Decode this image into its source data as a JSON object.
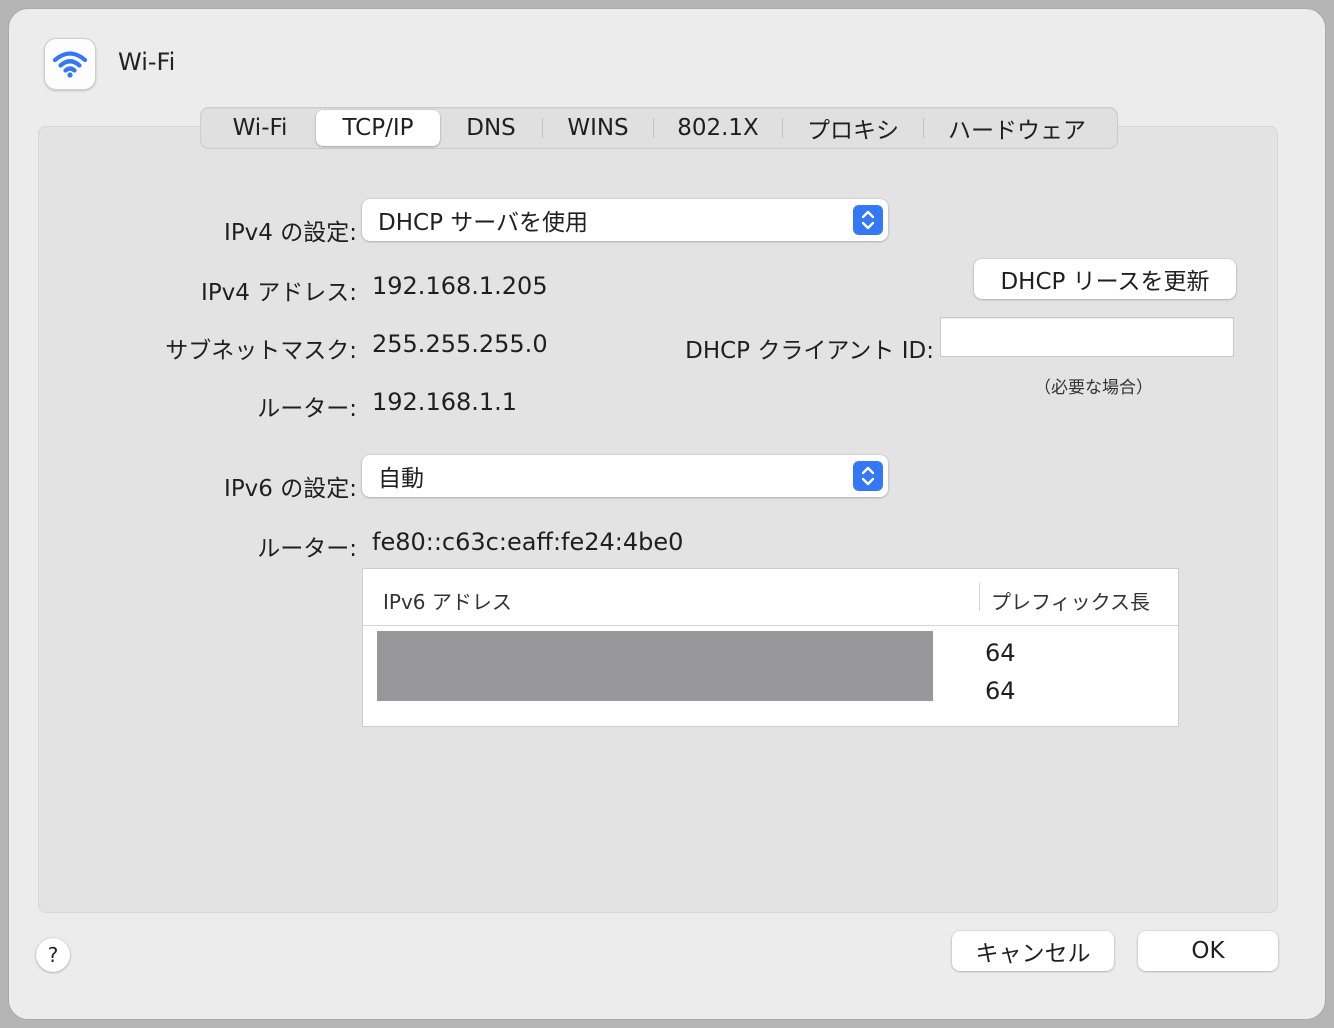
{
  "window": {
    "title": "Wi-Fi",
    "app_icon": "wifi-icon",
    "accent_color": "#3478f6"
  },
  "tabs": [
    {
      "label": "Wi-Fi",
      "active": false
    },
    {
      "label": "TCP/IP",
      "active": true
    },
    {
      "label": "DNS",
      "active": false
    },
    {
      "label": "WINS",
      "active": false
    },
    {
      "label": "802.1X",
      "active": false
    },
    {
      "label": "プロキシ",
      "active": false
    },
    {
      "label": "ハードウェア",
      "active": false
    }
  ],
  "ipv4": {
    "config_label": "IPv4 の設定:",
    "config_value": "DHCP サーバを使用",
    "address_label": "IPv4 アドレス:",
    "address_value": "192.168.1.205",
    "subnet_label": "サブネットマスク:",
    "subnet_value": "255.255.255.0",
    "router_label": "ルーター:",
    "router_value": "192.168.1.1",
    "renew_button": "DHCP リースを更新",
    "client_id_label": "DHCP クライアント ID:",
    "client_id_value": "",
    "client_id_hint": "（必要な場合）"
  },
  "ipv6": {
    "config_label": "IPv6 の設定:",
    "config_value": "自動",
    "router_label": "ルーター:",
    "router_value": "fe80::c63c:eaff:fe24:4be0",
    "table": {
      "headers": [
        "IPv6 アドレス",
        "プレフィックス長"
      ],
      "rows": [
        {
          "address": "",
          "prefix": "64"
        },
        {
          "address": "",
          "prefix": "64"
        }
      ]
    }
  },
  "footer": {
    "help_label": "?",
    "cancel_label": "キャンセル",
    "ok_label": "OK"
  }
}
